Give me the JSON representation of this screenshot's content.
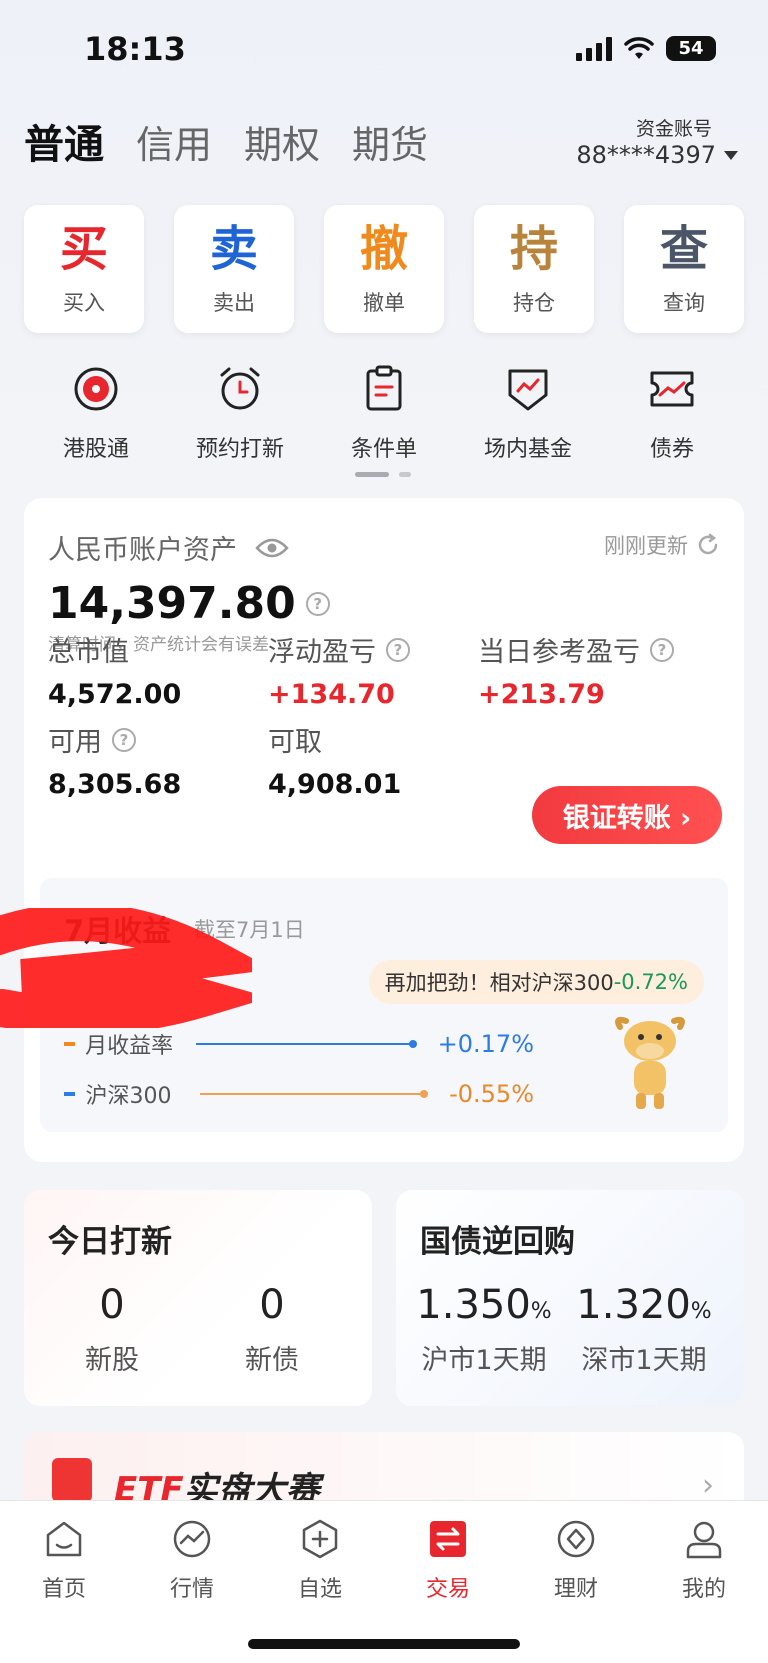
{
  "status_bar": {
    "time": "18:13",
    "battery": "54"
  },
  "account_tabs": [
    {
      "label": "普通",
      "active": true
    },
    {
      "label": "信用",
      "active": false
    },
    {
      "label": "期权",
      "active": false
    },
    {
      "label": "期货",
      "active": false
    }
  ],
  "account": {
    "label": "资金账号",
    "number": "88****4397"
  },
  "quick_actions": [
    {
      "glyph": "买",
      "label": "买入",
      "color": "#e8262d"
    },
    {
      "glyph": "卖",
      "label": "卖出",
      "color": "#1f64d6"
    },
    {
      "glyph": "撤",
      "label": "撤单",
      "color": "#f08a1c"
    },
    {
      "glyph": "持",
      "label": "持仓",
      "color": "#b8833a"
    },
    {
      "glyph": "查",
      "label": "查询",
      "color": "#4a5568"
    }
  ],
  "features": [
    {
      "label": "港股通",
      "icon": "hk-flower-icon"
    },
    {
      "label": "预约打新",
      "icon": "alarm-clock-icon"
    },
    {
      "label": "条件单",
      "icon": "clipboard-icon"
    },
    {
      "label": "场内基金",
      "icon": "shield-chart-icon"
    },
    {
      "label": "债券",
      "icon": "bond-chart-icon"
    }
  ],
  "assets": {
    "title": "人民币账户资产",
    "refresh": "刚刚更新",
    "total": "14,397.80",
    "note": "清算时间，资产统计会有误差",
    "market_value_label": "总市值",
    "market_value": "4,572.00",
    "floating_pl_label": "浮动盈亏",
    "floating_pl": "+134.70",
    "daily_pl_label": "当日参考盈亏",
    "daily_pl": "+213.79",
    "available_label": "可用",
    "available": "8,305.68",
    "withdrawable_label": "可取",
    "withdrawable": "4,908.01",
    "transfer_button": "银证转账"
  },
  "monthly": {
    "title": "7月收益",
    "date": "截至7月1日",
    "encourage_prefix": "再加把劲！相对沪深300",
    "encourage_value": "-0.72%",
    "legend": [
      {
        "name": "月收益率",
        "value": "+0.17%",
        "mark_color": "#f08a1c",
        "line_color": "#2d7be5",
        "value_color": "#2d7be5"
      },
      {
        "name": "沪深300",
        "value": "-0.55%",
        "mark_color": "#2d7be5",
        "line_color": "#f0a050",
        "value_color": "#e8892a"
      }
    ]
  },
  "ipo": {
    "title": "今日打新",
    "stocks_count": "0",
    "stocks_label": "新股",
    "bonds_count": "0",
    "bonds_label": "新债"
  },
  "repo": {
    "title": "国债逆回购",
    "sh_rate": "1.350",
    "sh_label": "沪市1天期",
    "sz_rate": "1.320",
    "sz_label": "深市1天期",
    "unit": "%"
  },
  "banner": {
    "prefix": "ETF",
    "text": "实盘大赛"
  },
  "tab_bar": [
    {
      "label": "首页",
      "icon": "home-icon",
      "active": false
    },
    {
      "label": "行情",
      "icon": "market-icon",
      "active": false
    },
    {
      "label": "自选",
      "icon": "watchlist-icon",
      "active": false
    },
    {
      "label": "交易",
      "icon": "trade-icon",
      "active": true
    },
    {
      "label": "理财",
      "icon": "wealth-icon",
      "active": false
    },
    {
      "label": "我的",
      "icon": "profile-icon",
      "active": false
    }
  ]
}
